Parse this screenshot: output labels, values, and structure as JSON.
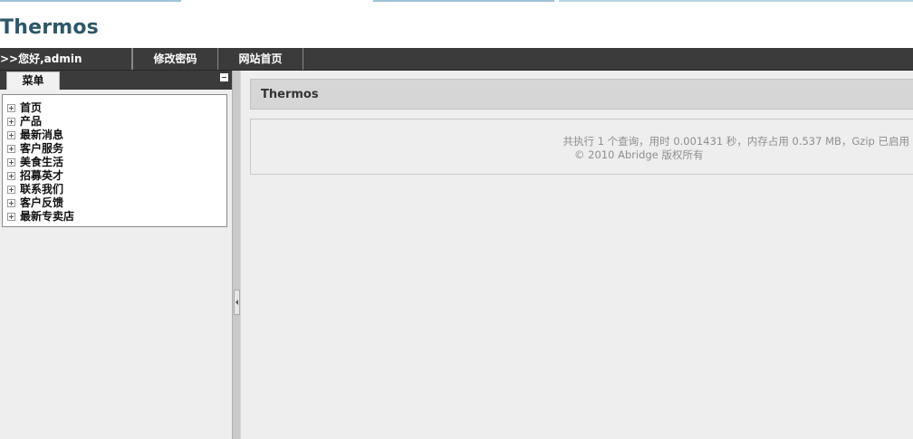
{
  "app": {
    "title": "Thermos"
  },
  "nav": {
    "greeting": ">>您好,admin",
    "items": [
      {
        "label": "修改密码"
      },
      {
        "label": "网站首页"
      }
    ]
  },
  "sidebar": {
    "tab_label": "菜单",
    "items": [
      {
        "label": "首页"
      },
      {
        "label": "产品"
      },
      {
        "label": "最新消息"
      },
      {
        "label": "客户服务"
      },
      {
        "label": "美食生活"
      },
      {
        "label": "招募英才"
      },
      {
        "label": "联系我们"
      },
      {
        "label": "客户反馈"
      },
      {
        "label": "最新专卖店"
      }
    ]
  },
  "main": {
    "panel_title": "Thermos",
    "footer_stats": "共执行 1 个查询，用时 0.001431 秒，内存占用 0.537 MB，Gzip 已启用",
    "copyright": "© 2010 Abridge 版权所有"
  }
}
